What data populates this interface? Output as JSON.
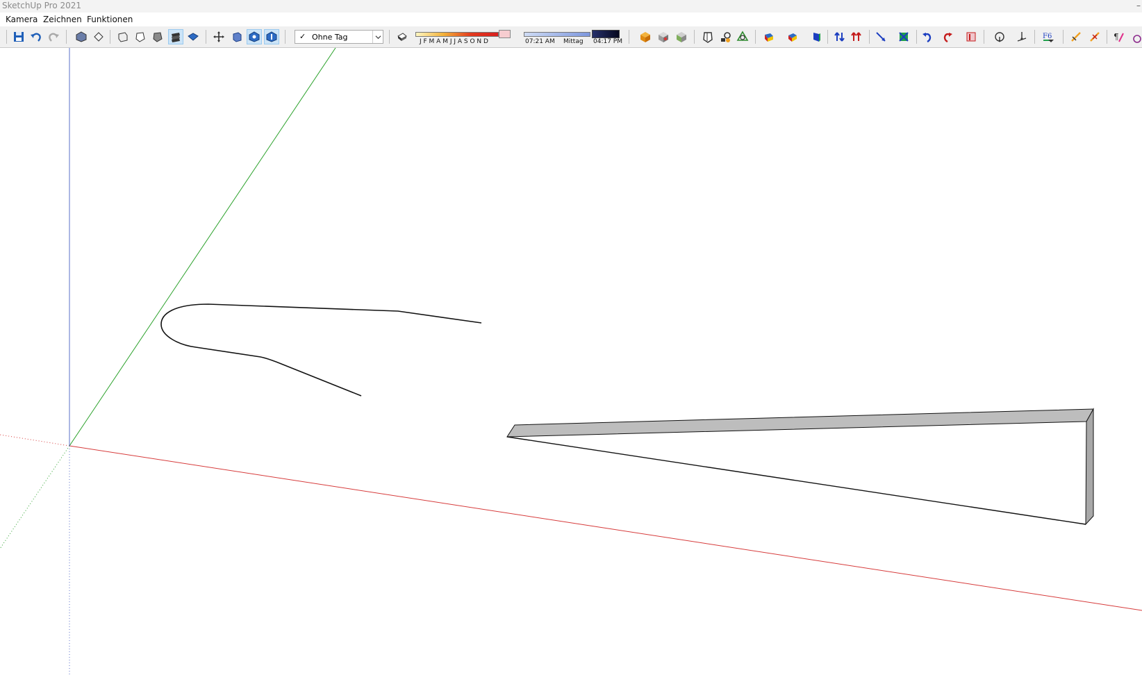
{
  "window": {
    "title": "SketchUp Pro 2021",
    "minimize_glyph": "–"
  },
  "menu": [
    {
      "label": "Kamera"
    },
    {
      "label": "Zeichnen"
    },
    {
      "label": "Funktionen"
    }
  ],
  "tag_selector": {
    "check": "✓",
    "value": "Ohne Tag"
  },
  "shadow_settings": {
    "months_label": "J F M A M J J A S O N D",
    "time_start": "07:21 AM",
    "time_mid": "Mittag",
    "time_end": "04:17 PM"
  },
  "icons": [
    "save-icon",
    "undo-icon",
    "redo-icon",
    "iso-view-icon",
    "top-view-icon",
    "front-view-icon",
    "right-view-icon",
    "back-view-icon",
    "left-view-icon",
    "bottom-view-icon",
    "orbit-icon",
    "pan-icon",
    "zoom-icon",
    "zoom-extents-icon",
    "shadow-toggle-icon",
    "warehouse-icon",
    "extension-warehouse-icon",
    "component-icon",
    "sandbox-icon",
    "solid-tools-icon",
    "push-pull-icon",
    "follow-me-icon",
    "offset-icon",
    "move-icon",
    "rotate-icon",
    "scale-icon",
    "flip-icon",
    "undo-arrow-icon",
    "redo-arrow-icon",
    "eraser-icon",
    "tape-measure-icon",
    "protractor-icon",
    "fredo-icon",
    "axes-icon",
    "section-icon",
    "paint-icon"
  ],
  "colors": {
    "red_axis": "#d63a3a",
    "green_axis": "#2aa12a",
    "blue_axis": "#5a6fc8",
    "edge": "#111111",
    "face_top": "#bdbdbd",
    "face_side": "#a8a8a8",
    "active_tool": "#cce4f7"
  }
}
